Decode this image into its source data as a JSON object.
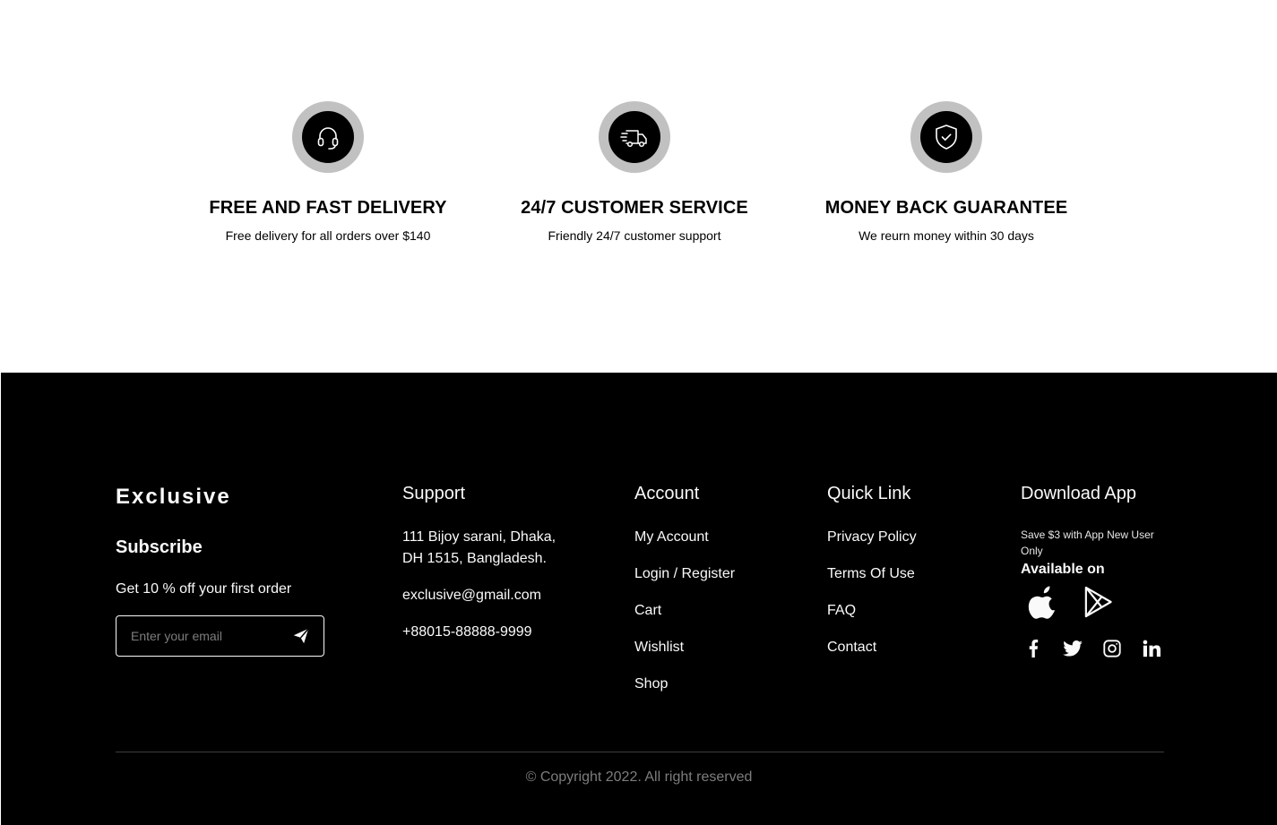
{
  "features": [
    {
      "icon": "headphones-icon",
      "title": "FREE AND FAST DELIVERY",
      "desc": "Free delivery for all orders over $140"
    },
    {
      "icon": "delivery-truck-icon",
      "title": "24/7 CUSTOMER SERVICE",
      "desc": "Friendly 24/7 customer support"
    },
    {
      "icon": "shield-check-icon",
      "title": "MONEY BACK GUARANTEE",
      "desc": "We reurn money within 30 days"
    }
  ],
  "footer": {
    "brand": "Exclusive",
    "subscribe_title": "Subscribe",
    "offer": "Get 10 % off your first order",
    "email_placeholder": "Enter your email",
    "support": {
      "title": "Support",
      "address_line1": "111 Bijoy sarani, Dhaka,",
      "address_line2": "DH 1515, Bangladesh.",
      "email": "exclusive@gmail.com",
      "phone": "+88015-88888-9999"
    },
    "account": {
      "title": "Account",
      "items": [
        "My Account",
        "Login / Register",
        "Cart",
        "Wishlist",
        "Shop"
      ]
    },
    "quick_link": {
      "title": "Quick Link",
      "items": [
        "Privacy Policy",
        "Terms Of Use",
        "FAQ",
        "Contact"
      ]
    },
    "download": {
      "title": "Download App",
      "note": "Save $3 with App New User Only",
      "available": "Available on",
      "stores": [
        "apple-icon",
        "google-play-icon"
      ],
      "socials": [
        "facebook-icon",
        "twitter-icon",
        "instagram-icon",
        "linkedin-icon"
      ]
    },
    "copyright": "© Copyright 2022. All right reserved"
  },
  "colors": {
    "background": "#ffffff",
    "footer_background": "#000000",
    "footer_text": "#fafafa",
    "muted_text": "#7d7d7d",
    "icon_ring": "#c1c1c1"
  }
}
